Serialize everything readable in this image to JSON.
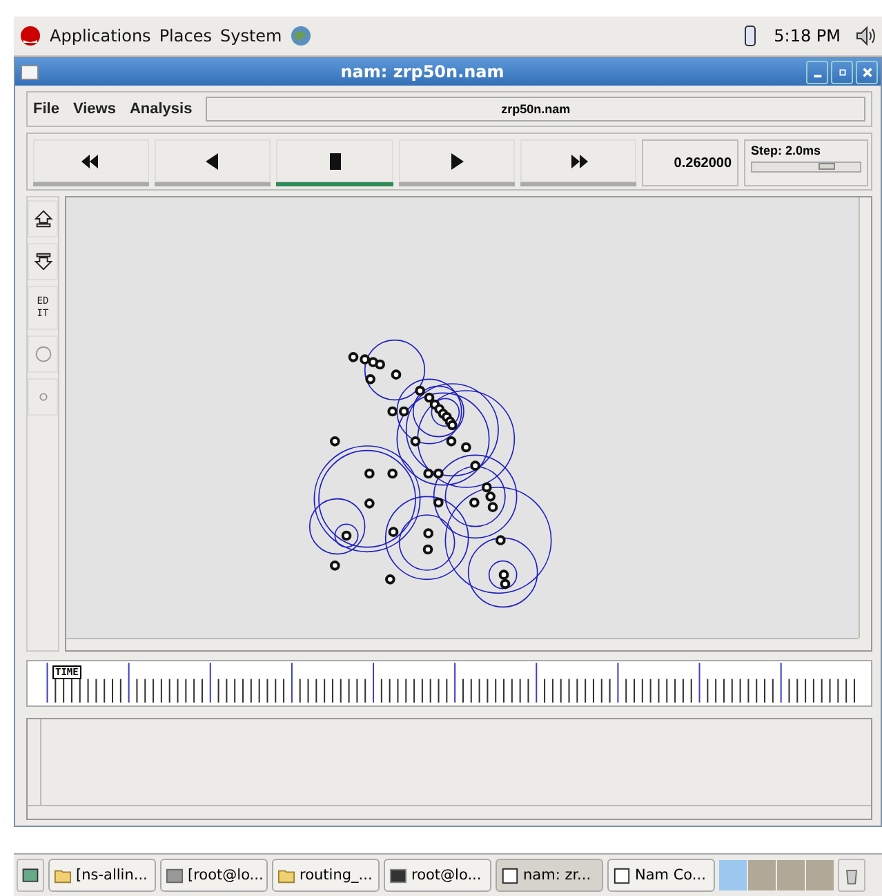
{
  "top_panel": {
    "menus": [
      "Applications",
      "Places",
      "System"
    ],
    "clock": "5:18 PM"
  },
  "window": {
    "title": "nam: zrp50n.nam"
  },
  "menu_bar": {
    "items": [
      "File",
      "Views",
      "Analysis"
    ],
    "file_name": "zrp50n.nam"
  },
  "transport": {
    "buttons": [
      {
        "kind": "rewind",
        "selected": false
      },
      {
        "kind": "back",
        "selected": false
      },
      {
        "kind": "stop",
        "selected": true
      },
      {
        "kind": "play",
        "selected": false
      },
      {
        "kind": "forward",
        "selected": false
      }
    ],
    "time": "0.262000",
    "step_label": "Step: 2.0ms",
    "step_slider": {
      "level": 0.72
    }
  },
  "tools": [
    {
      "kind": "zoom-in"
    },
    {
      "kind": "zoom-out"
    },
    {
      "kind": "edit",
      "label": "EDIT"
    },
    {
      "kind": "circle"
    },
    {
      "kind": "dot"
    }
  ],
  "timeline": {
    "label": "TIME"
  },
  "taskbar": {
    "items": [
      {
        "kind": "folder",
        "label": "[ns-allin...",
        "selected": false
      },
      {
        "kind": "terminal-grey",
        "label": "[root@lo...",
        "selected": false
      },
      {
        "kind": "folder",
        "label": "routing_...",
        "selected": false
      },
      {
        "kind": "terminal",
        "label": "root@lo...",
        "selected": false
      },
      {
        "kind": "window",
        "label": "nam: zr...",
        "selected": true
      },
      {
        "kind": "window",
        "label": "Nam Co...",
        "selected": false
      }
    ],
    "workspaces": [
      {
        "selected": true
      },
      {
        "selected": false
      },
      {
        "selected": false
      },
      {
        "selected": false
      }
    ]
  }
}
